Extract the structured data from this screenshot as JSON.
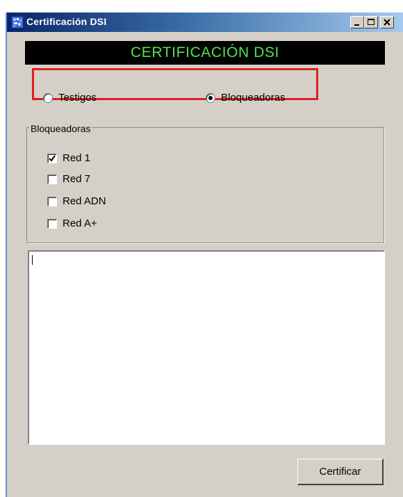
{
  "window": {
    "title": "Certificación DSI",
    "buttons": [
      "minimize",
      "maximize",
      "close"
    ]
  },
  "banner": {
    "text": "CERTIFICACIÓN DSI",
    "text_color": "#54e34d",
    "background": "#000000"
  },
  "mode_selector": {
    "highlight_color": "#e31b23",
    "options": [
      {
        "label": "Testigos",
        "selected": false
      },
      {
        "label": "Bloqueadoras",
        "selected": true
      }
    ]
  },
  "group": {
    "legend": "Bloqueadoras",
    "items": [
      {
        "label": "Red 1",
        "checked": true
      },
      {
        "label": "Red 7",
        "checked": false
      },
      {
        "label": "Red ADN",
        "checked": false
      },
      {
        "label": "Red A+",
        "checked": false
      }
    ]
  },
  "output": {
    "value": ""
  },
  "actions": {
    "certify_label": "Certificar"
  }
}
